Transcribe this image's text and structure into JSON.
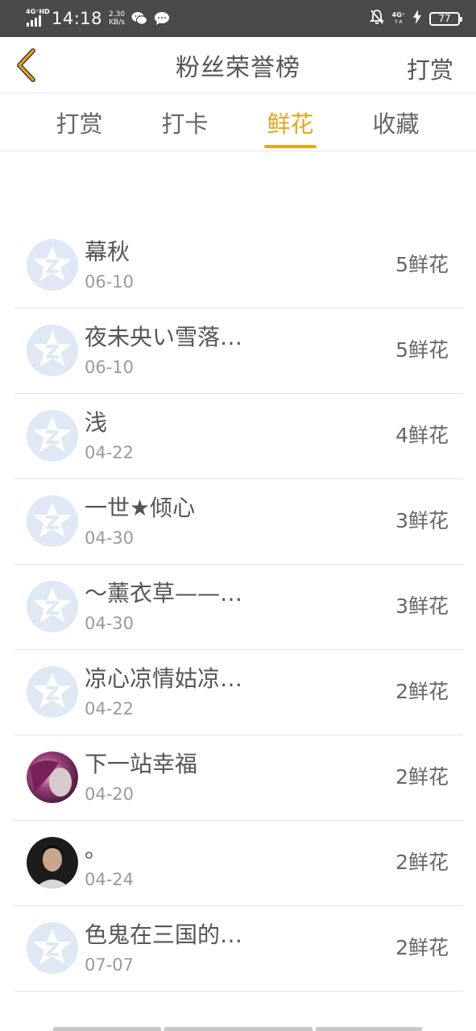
{
  "status_bar": {
    "network_tag": "4G⁺HD",
    "time": "14:18",
    "speed_value": "2.30",
    "speed_unit": "KB/s",
    "network_right": "4G⁺",
    "network_right_sub": "Y A",
    "battery": "77"
  },
  "header": {
    "title": "粉丝荣誉榜",
    "action_label": "打赏"
  },
  "tabs": [
    {
      "label": "打赏",
      "active": false
    },
    {
      "label": "打卡",
      "active": false
    },
    {
      "label": "鲜花",
      "active": true
    },
    {
      "label": "收藏",
      "active": false
    }
  ],
  "colors": {
    "accent": "#e9a51c",
    "status_bar_bg": "#4a4a4a",
    "default_avatar_bg": "#dfe8f4"
  },
  "fans": [
    {
      "name": "幕秋",
      "date": "06-10",
      "count": "5鲜花",
      "avatar": "default-avatar-icon"
    },
    {
      "name": "夜未央い雪落…",
      "date": "06-10",
      "count": "5鲜花",
      "avatar": "default-avatar-icon"
    },
    {
      "name": "浅",
      "date": "04-22",
      "count": "4鲜花",
      "avatar": "default-avatar-icon"
    },
    {
      "name": "一世★倾心",
      "date": "04-30",
      "count": "3鲜花",
      "avatar": "default-avatar-icon"
    },
    {
      "name": "～薰衣草——…",
      "date": "04-30",
      "count": "3鲜花",
      "avatar": "default-avatar-icon"
    },
    {
      "name": "凉心凉情姑凉…",
      "date": "04-22",
      "count": "2鲜花",
      "avatar": "default-avatar-icon"
    },
    {
      "name": "下一站幸福",
      "date": "04-20",
      "count": "2鲜花",
      "avatar": "photo-avatar-purple-hair"
    },
    {
      "name": "。",
      "date": "04-24",
      "count": "2鲜花",
      "avatar": "photo-avatar-man"
    },
    {
      "name": "色鬼在三国的…",
      "date": "07-07",
      "count": "2鲜花",
      "avatar": "default-avatar-icon"
    }
  ]
}
